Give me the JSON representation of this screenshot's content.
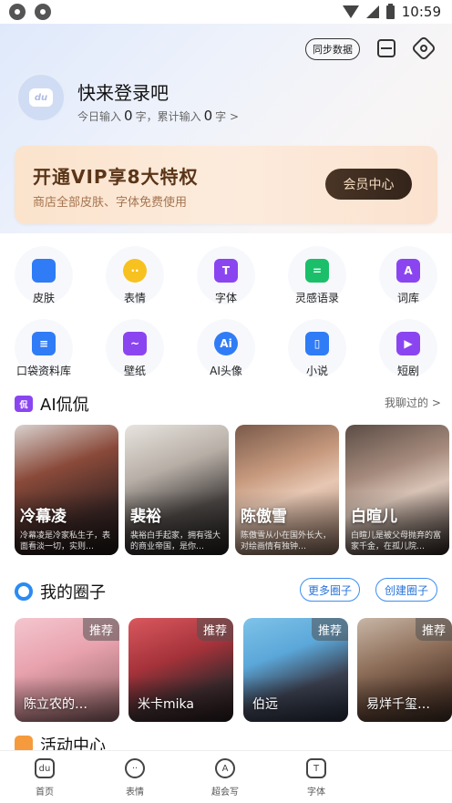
{
  "status_bar": {
    "time": "10:59"
  },
  "header": {
    "sync_label": "同步数据",
    "avatar_text": "du",
    "login_title": "快来登录吧",
    "today_label": "今日输入",
    "today_count": "0",
    "char_unit": "字，累计输入",
    "total_count": "0",
    "total_unit": "字 >"
  },
  "vip": {
    "title": "开通VIP享8大特权",
    "subtitle": "商店全部皮肤、字体免费使用",
    "button": "会员中心"
  },
  "features": [
    {
      "label": "皮肤",
      "icon": "shirt-icon",
      "color": "#2f7cf6",
      "glyph": ""
    },
    {
      "label": "表情",
      "icon": "emoji-icon",
      "color": "#f7c21f",
      "glyph": "··"
    },
    {
      "label": "字体",
      "icon": "font-icon",
      "color": "#8b45f0",
      "glyph": "T"
    },
    {
      "label": "灵感语录",
      "icon": "chat-icon",
      "color": "#1bbf6a",
      "glyph": "="
    },
    {
      "label": "词库",
      "icon": "dictionary-icon",
      "color": "#8b45f0",
      "glyph": "A"
    },
    {
      "label": "口袋资料库",
      "icon": "document-icon",
      "color": "#2f7cf6",
      "glyph": "≡"
    },
    {
      "label": "壁纸",
      "icon": "wallpaper-icon",
      "color": "#8b45f0",
      "glyph": "~"
    },
    {
      "label": "AI头像",
      "icon": "ai-avatar-icon",
      "color": "#2f7cf6",
      "glyph": "Ai"
    },
    {
      "label": "小说",
      "icon": "book-icon",
      "color": "#2f7cf6",
      "glyph": "▯"
    },
    {
      "label": "短剧",
      "icon": "video-icon",
      "color": "#8b45f0",
      "glyph": "▶"
    }
  ],
  "ai_section": {
    "badge": "侃",
    "title": "AI侃侃",
    "history_link": "我聊过的 >"
  },
  "characters": [
    {
      "name": "冷幕凌",
      "desc": "冷幕凌是冷家私生子，表面看淡一切，实则…",
      "bg": "linear-gradient(160deg,#d9d2cf 0%,#8a4a3a 35%,#3a2624 70%,#1d1715 100%)"
    },
    {
      "name": "裴裕",
      "desc": "裴裕白手起家，拥有强大的商业帝国，是你…",
      "bg": "linear-gradient(160deg,#e8e4df 0%,#b7aea6 35%,#4b4644 65%,#22201f 100%)"
    },
    {
      "name": "陈傲雪",
      "desc": "陈傲雪从小在国外长大，对绘画情有独钟…",
      "bg": "linear-gradient(160deg,#7a5a4a 0%,#c79a7e 35%,#e7c7b3 55%,#8a6d5c 100%)"
    },
    {
      "name": "白暄儿",
      "desc": "白暄儿是被父母抛弃的富家千金，在孤儿院…",
      "bg": "linear-gradient(160deg,#5b4c45 0%,#a58a7c 35%,#d8c3b6 55%,#2d2421 100%)"
    }
  ],
  "circles_section": {
    "title": "我的圈子",
    "more_button": "更多圈子",
    "create_button": "创建圈子"
  },
  "groups": [
    {
      "tag": "推荐",
      "name": "陈立农的…",
      "bg": "linear-gradient(160deg,#f4c6cf 0%,#e8a2ae 40%,#b88086 70%,#6d4a4c 100%)"
    },
    {
      "tag": "推荐",
      "name": "米卡mika",
      "bg": "linear-gradient(160deg,#d9585e 0%,#a5323a 40%,#3c2a2d 70%,#1c1416 100%)"
    },
    {
      "tag": "推荐",
      "name": "伯远",
      "bg": "linear-gradient(160deg,#7ec3e9 0%,#5ba7d9 35%,#3a3f4e 65%,#1d2330 100%)"
    },
    {
      "tag": "推荐",
      "name": "易烊千玺…",
      "bg": "linear-gradient(160deg,#c8b6a6 0%,#8e6f5a 40%,#5a4032 70%,#2d211a 100%)"
    }
  ],
  "activity": {
    "title": "活动中心"
  },
  "tabs": [
    {
      "label": "首页",
      "glyph": "du"
    },
    {
      "label": "表情",
      "glyph": "··"
    },
    {
      "label": "超会写",
      "glyph": "A"
    },
    {
      "label": "字体",
      "glyph": "T"
    }
  ]
}
